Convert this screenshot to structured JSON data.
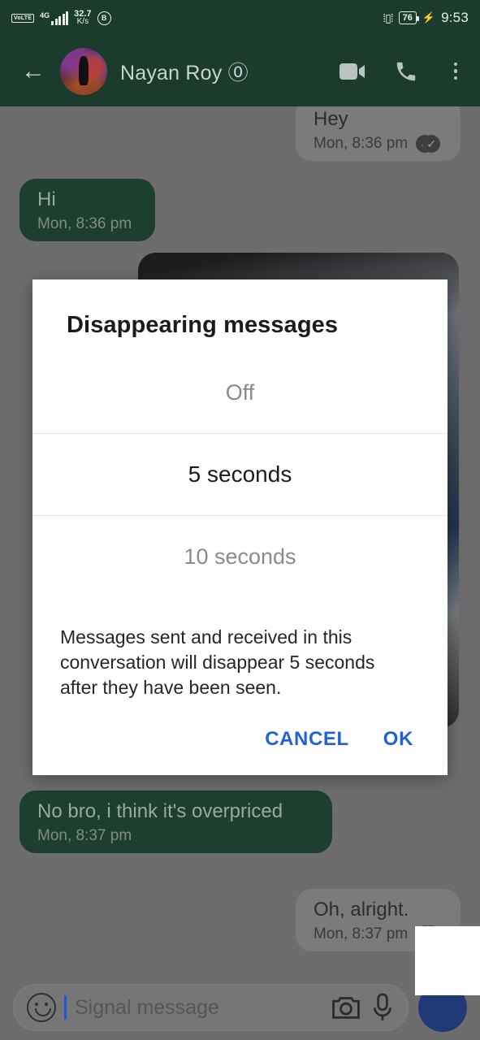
{
  "status_bar": {
    "volte_label": "VoLTE",
    "network_type": "4G",
    "net_speed_value": "32.7",
    "net_speed_unit": "K/s",
    "bluetooth_badge": "B",
    "vibrate_icon": "vibrate-icon",
    "battery_percent": "76",
    "charging_icon": "bolt-icon",
    "clock": "9:53"
  },
  "app_bar": {
    "back_icon": "back-arrow-icon",
    "avatar": "contact-avatar",
    "contact_name": "Nayan Roy ⓪",
    "video_call_icon": "video-call-icon",
    "voice_call_icon": "phone-call-icon",
    "overflow_icon": "overflow-menu-icon"
  },
  "chat": {
    "messages": [
      {
        "text": "Hey",
        "time": "Mon, 8:36 pm",
        "direction": "incoming",
        "receipt": "read-receipt-double-check"
      },
      {
        "text": "Hi",
        "time": "Mon, 8:36 pm",
        "direction": "outgoing",
        "receipt": ""
      },
      {
        "text": "",
        "time": "",
        "direction": "incoming",
        "receipt": "",
        "kind": "image-attachment"
      },
      {
        "text": "No bro, i think it's overpriced",
        "time": "Mon, 8:37 pm",
        "direction": "outgoing",
        "receipt": ""
      },
      {
        "text": "Oh, alright.",
        "time": "Mon, 8:37 pm",
        "direction": "incoming",
        "receipt": "read-receipt-double-check"
      }
    ]
  },
  "compose": {
    "emoji_icon": "emoji-icon",
    "placeholder": "Signal message",
    "camera_icon": "camera-icon",
    "mic_icon": "microphone-icon",
    "send_icon": "send-button"
  },
  "dialog": {
    "title": "Disappearing messages",
    "options": [
      {
        "label": "Off",
        "selected": false
      },
      {
        "label": "5 seconds",
        "selected": true
      },
      {
        "label": "10 seconds",
        "selected": false
      }
    ],
    "description": "Messages sent and received in this conversation will disappear 5 seconds after they have been seen.",
    "cancel_label": "CANCEL",
    "ok_label": "OK"
  },
  "colors": {
    "brand_green": "#1b3b2d",
    "bubble_out": "#1d3f2f",
    "bubble_in": "#7b7b7b",
    "scrim": "#6d6d6d",
    "dialog_accent": "#1f63d8",
    "send_button": "#1f3a77"
  }
}
